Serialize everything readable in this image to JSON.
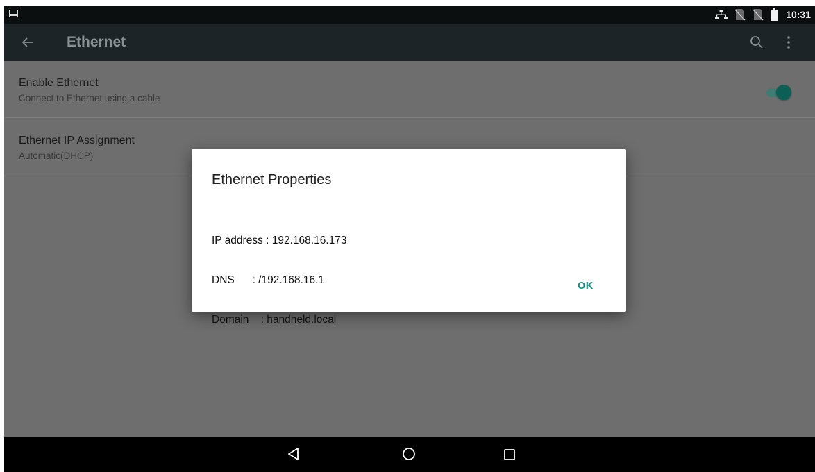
{
  "status_bar": {
    "time": "10:31",
    "icons": [
      "screenshot-icon",
      "ethernet-icon",
      "no-sim-icon",
      "no-sim-icon",
      "battery-icon"
    ]
  },
  "app_bar": {
    "title": "Ethernet",
    "icons": [
      "back-arrow-icon",
      "search-icon",
      "more-vert-icon"
    ]
  },
  "settings": {
    "enable_ethernet": {
      "title": "Enable Ethernet",
      "summary": "Connect to Ethernet using a cable",
      "enabled": true
    },
    "ip_assignment": {
      "title": "Ethernet IP Assignment",
      "summary": "Automatic(DHCP)"
    }
  },
  "dialog": {
    "title": "Ethernet Properties",
    "lines": [
      "IP address : 192.168.16.173",
      "DNS      : /192.168.16.1",
      "Domain    : handheld.local"
    ],
    "ok_label": "OK"
  },
  "nav_bar": {
    "icons": [
      "nav-back-icon",
      "nav-home-icon",
      "nav-recents-icon"
    ]
  },
  "colors": {
    "accent": "#0f8f84",
    "toggle_thumb": "#0b5f55",
    "app_bar": "#1d2427",
    "status_bar": "#0c0f10",
    "scrim_background": "#6e6e6e"
  }
}
